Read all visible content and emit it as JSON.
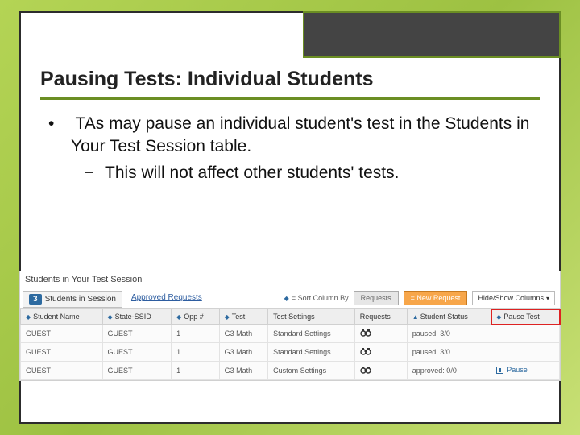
{
  "slide": {
    "title": "Pausing Tests: Individual Students",
    "bullet": "TAs may pause an individual student's test in the Students in Your Test Session table.",
    "sub_bullet": "This will not affect other students' tests."
  },
  "panel": {
    "title": "Students in Your Test Session",
    "session_count": "3",
    "tab_label": "Students in Session",
    "approved_link": "Approved Requests",
    "sort_hint": "= Sort Column By",
    "btn_requests": "Requests",
    "btn_new": "= New Request",
    "hide_show": "Hide/Show Columns"
  },
  "columns": {
    "student_name": "Student Name",
    "state_ssid": "State-SSID",
    "opp": "Opp #",
    "test": "Test",
    "test_settings": "Test Settings",
    "requests": "Requests",
    "student_status": "Student Status",
    "pause_test": "Pause Test"
  },
  "rows": [
    {
      "name": "GUEST",
      "ssid": "GUEST",
      "opp": "1",
      "test": "G3 Math",
      "settings": "Standard Settings",
      "status": "paused: 3/0",
      "pause": ""
    },
    {
      "name": "GUEST",
      "ssid": "GUEST",
      "opp": "1",
      "test": "G3 Math",
      "settings": "Standard Settings",
      "status": "paused: 3/0",
      "pause": ""
    },
    {
      "name": "GUEST",
      "ssid": "GUEST",
      "opp": "1",
      "test": "G3 Math",
      "settings": "Custom Settings",
      "status": "approved: 0/0",
      "pause": "Pause"
    }
  ]
}
